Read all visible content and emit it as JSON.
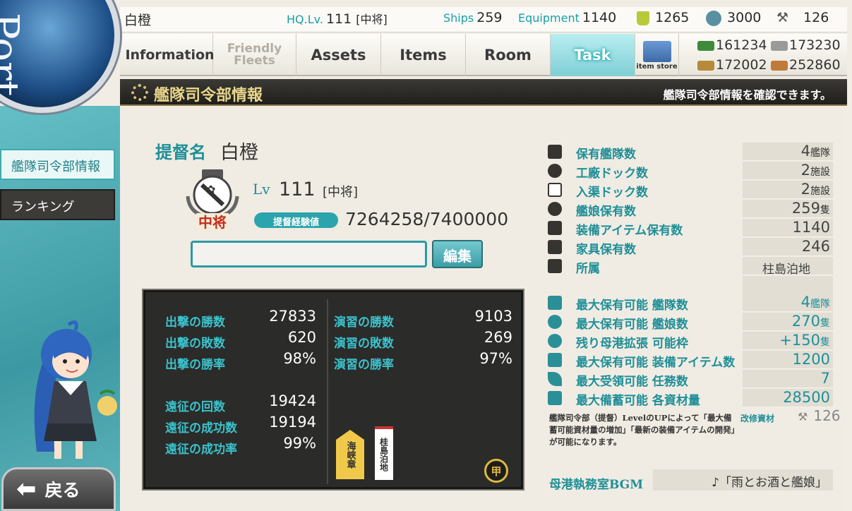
{
  "topbar": {
    "admiral_name": "白橙",
    "hq_label": "HQ.Lv.",
    "hq_value": "111",
    "hq_rank": "[中将]",
    "ships_label": "Ships",
    "ships_value": "259",
    "equip_label": "Equipment",
    "equip_value": "1140",
    "bucket_value": "1265",
    "devmat_value": "3000",
    "screw_value": "126"
  },
  "nav": {
    "information": "Information",
    "friendly_l1": "Friendly",
    "friendly_l2": "Fleets",
    "assets": "Assets",
    "items": "Items",
    "room": "Room",
    "task": "Task",
    "item_store": "item store"
  },
  "resources": {
    "fuel": "161234",
    "steel": "173230",
    "ammo": "172002",
    "bauxite": "252860"
  },
  "title": {
    "main": "艦隊司令部情報",
    "sub": "艦隊司令部情報を確認できます。"
  },
  "sidebar": {
    "port": "Port",
    "items": [
      {
        "label": "艦隊司令部情報"
      },
      {
        "label": "ランキング"
      }
    ],
    "back": "戻る"
  },
  "profile": {
    "name_label": "提督名",
    "name": "白橙",
    "lv_label": "Lv",
    "lv": "111",
    "rank": "[中将]",
    "rank_badge": "中将",
    "exp_label": "提督経験値",
    "exp": "7264258/7400000",
    "comment": "",
    "edit": "編集"
  },
  "stats": {
    "sortie_win_label": "出撃の勝数",
    "sortie_win": "27833",
    "sortie_lose_label": "出撃の敗数",
    "sortie_lose": "620",
    "sortie_rate_label": "出撃の勝率",
    "sortie_rate": "98%",
    "pvp_win_label": "演習の勝数",
    "pvp_win": "9103",
    "pvp_lose_label": "演習の敗数",
    "pvp_lose": "269",
    "pvp_rate_label": "演習の勝率",
    "pvp_rate": "97%",
    "exp_count_label": "遠征の回数",
    "exp_count": "19424",
    "exp_success_label": "遠征の成功数",
    "exp_success": "19194",
    "exp_rate_label": "遠征の成功率",
    "exp_rate": "99%",
    "medal1": "海峡章",
    "medal2": "桂島泊地",
    "medal3": "甲"
  },
  "panel": {
    "fleets_label": "保有艦隊数",
    "fleets": "4",
    "fleets_unit": "艦隊",
    "docks_label": "工廠ドック数",
    "docks": "2",
    "docks_unit": "施設",
    "repair_label": "入渠ドック数",
    "repair": "2",
    "repair_unit": "施設",
    "ships_label": "艦娘保有数",
    "ships": "259",
    "ships_unit": "隻",
    "equip_label": "装備アイテム保有数",
    "equip": "1140",
    "furniture_label": "家具保有数",
    "furniture": "246",
    "base_label": "所属",
    "base": "柱島泊地",
    "max_fleets_label": "最大保有可能 艦隊数",
    "max_fleets": "4",
    "max_fleets_unit": "艦隊",
    "max_ships_label": "最大保有可能 艦娘数",
    "max_ships": "270",
    "max_ships_unit": "隻",
    "expand_label": "残り母港拡張 可能枠",
    "expand": "+150",
    "expand_unit": "隻",
    "max_equip_label": "最大保有可能 装備アイテム数",
    "max_equip": "1200",
    "max_quests_label": "最大受領可能 任務数",
    "max_quests": "7",
    "max_res_label": "最大備蓄可能 各資材量",
    "max_res": "28500",
    "note": "艦隊司令部（提督）LevelのUPによって「最大備蓄可能資材量の増加」「最新の装備アイテムの開発」が可能になります。",
    "kaishu_label": "改修資材",
    "kaishu": "126",
    "bgm_label": "母港執務室BGM",
    "bgm": "♪「雨とお酒と艦娘」"
  },
  "colors": {
    "accent": "#1f8f98",
    "title_gold": "#e9d68a",
    "panel_dark": "#2b2b29"
  }
}
